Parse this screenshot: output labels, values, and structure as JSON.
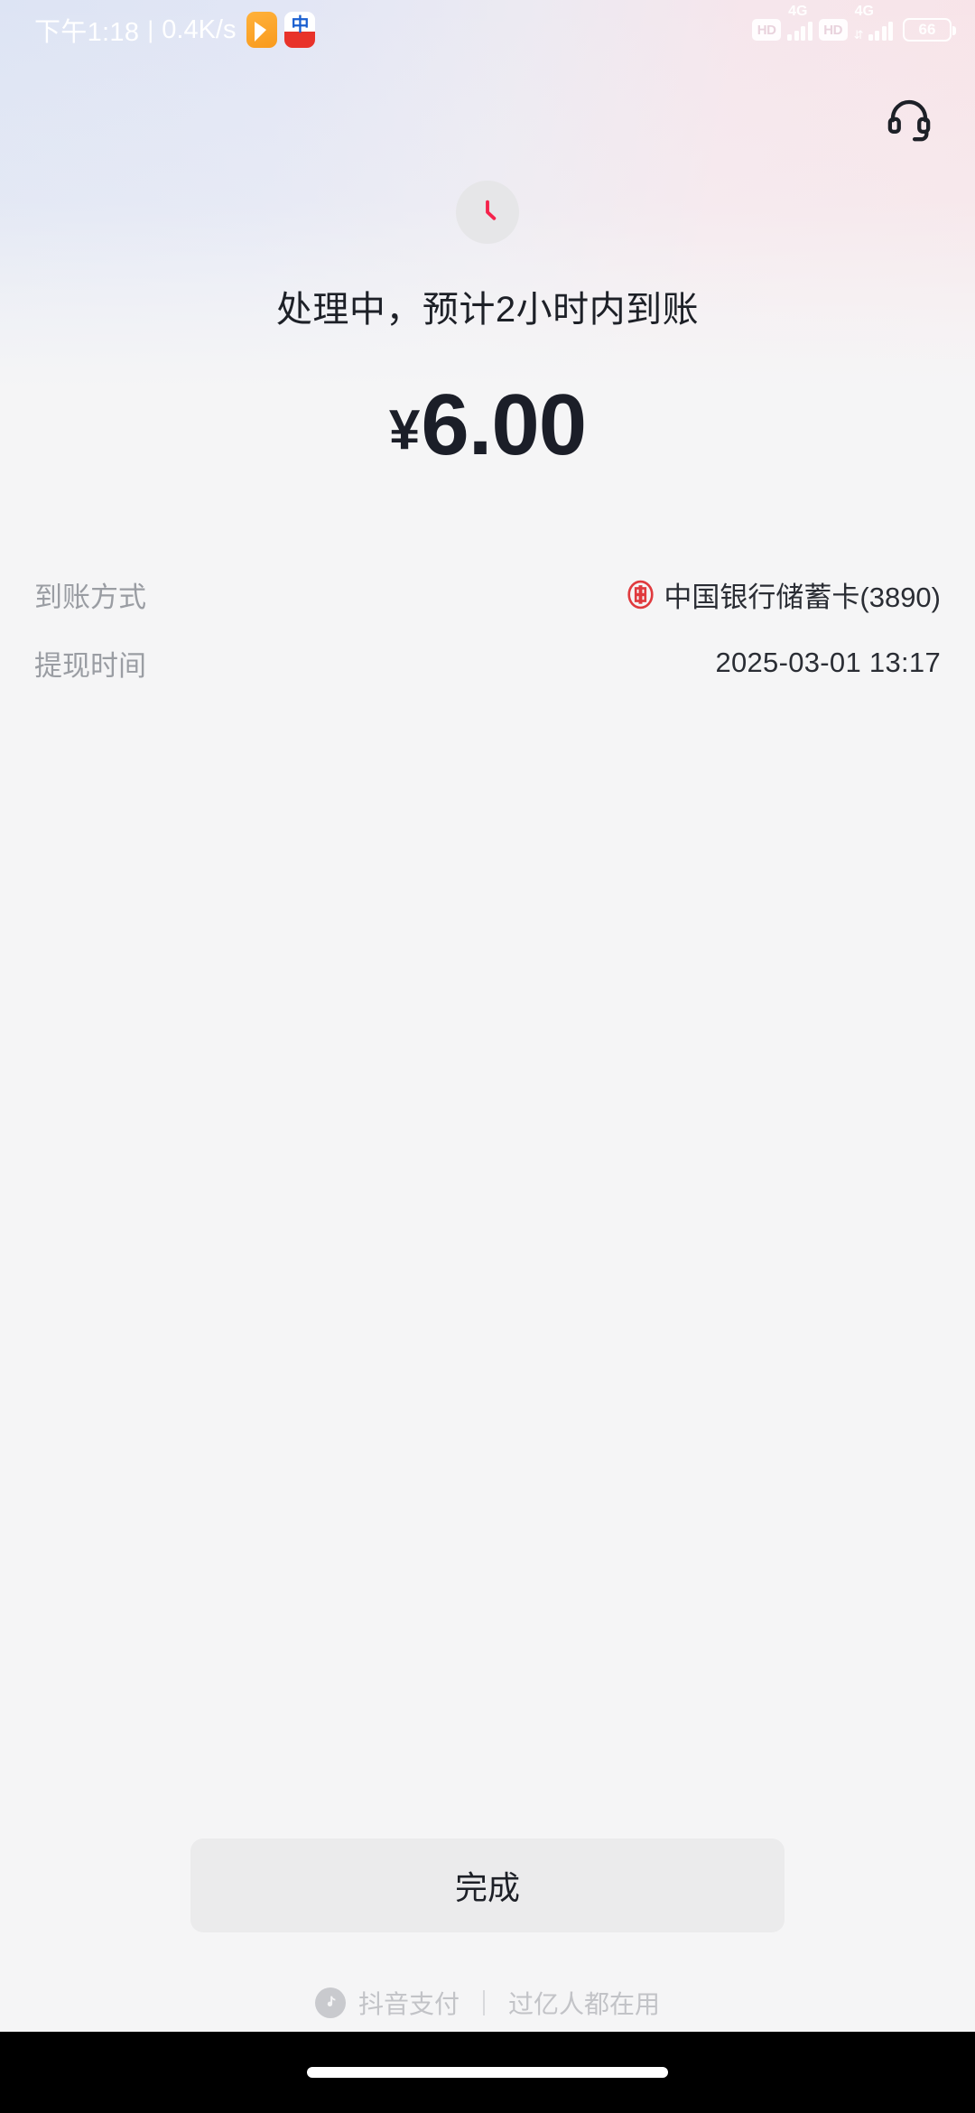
{
  "status_bar": {
    "time": "下午1:18",
    "separator": "|",
    "network_speed": "0.4K/s",
    "app_icons": [
      {
        "name": "note-app-icon",
        "label": ""
      },
      {
        "name": "bank-app-icon",
        "label": "中"
      }
    ],
    "sim1": {
      "hd": "HD",
      "network": "4G"
    },
    "sim2": {
      "hd": "HD",
      "network": "4G"
    },
    "battery_percent": "66"
  },
  "header": {
    "support_icon": "headset-icon"
  },
  "transaction": {
    "status_icon": "clock-icon",
    "status_title": "处理中，预计2小时内到账",
    "currency_symbol": "¥",
    "amount": "6.00"
  },
  "details": [
    {
      "label": "到账方式",
      "value": "中国银行储蓄卡(3890)",
      "icon": "bank-of-china-logo"
    },
    {
      "label": "提现时间",
      "value": "2025-03-01 13:17",
      "icon": ""
    }
  ],
  "actions": {
    "done_label": "完成"
  },
  "footer": {
    "logo_icon": "douyin-note-icon",
    "brand_name": "抖音支付",
    "divider": "|",
    "tagline": "过亿人都在用"
  },
  "colors": {
    "accent_red": "#f5224b",
    "boc_red": "#e03a3e",
    "amount_text": "#1b1e28",
    "label_gray": "#9a9da3",
    "background": "#f5f5f6",
    "button_bg": "#ebebec"
  }
}
